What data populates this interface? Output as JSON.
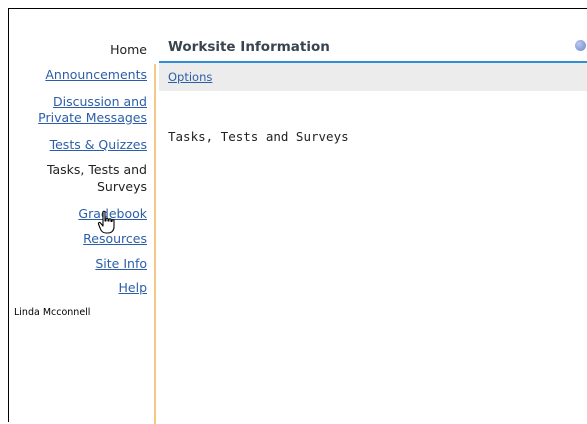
{
  "sidebar": {
    "items": [
      {
        "label": "Home"
      },
      {
        "label": "Announcements"
      },
      {
        "label": "Discussion and"
      },
      {
        "label": "Private Messages"
      },
      {
        "label": "Tests & Quizzes"
      },
      {
        "label": "Tasks, Tests and"
      },
      {
        "label": "Surveys"
      },
      {
        "label": "Gradebook"
      },
      {
        "label": "Resources"
      },
      {
        "label": "Site Info"
      },
      {
        "label": "Help"
      }
    ],
    "user_name": "Linda Mcconnell"
  },
  "main": {
    "title": "Worksite Information",
    "options_label": "Options",
    "content": "Tasks, Tests and Surveys"
  },
  "icons": {
    "help": "help-icon",
    "cursor": "hand-pointer-icon"
  }
}
